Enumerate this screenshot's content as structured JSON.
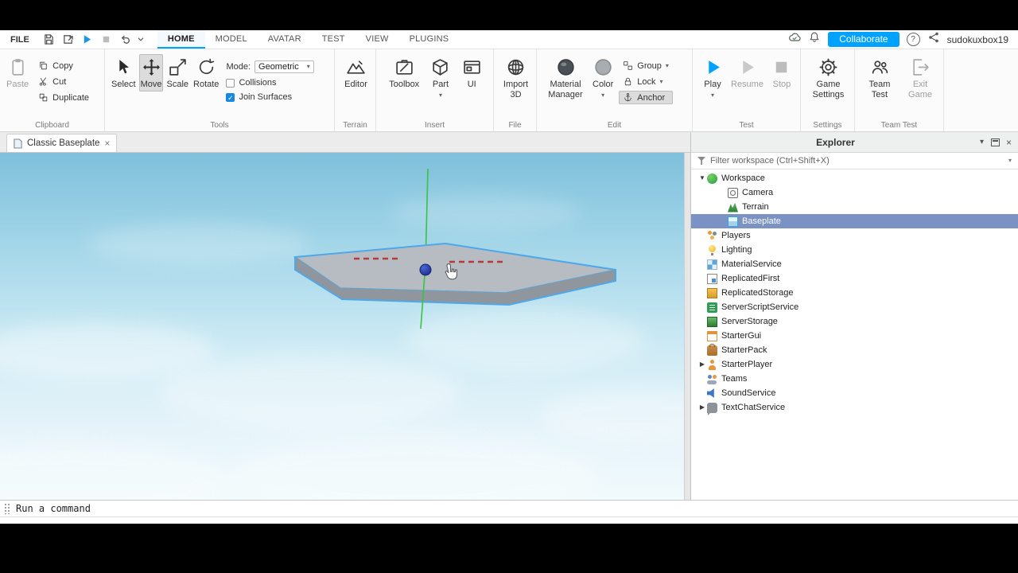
{
  "titlebar": {
    "file_label": "FILE",
    "tabs": [
      {
        "label": "HOME",
        "active": true
      },
      {
        "label": "MODEL",
        "active": false
      },
      {
        "label": "AVATAR",
        "active": false
      },
      {
        "label": "TEST",
        "active": false
      },
      {
        "label": "VIEW",
        "active": false
      },
      {
        "label": "PLUGINS",
        "active": false
      }
    ],
    "quick_icons": [
      "save-icon",
      "publish-icon",
      "play-icon",
      "pause-icon",
      "undo-icon",
      "dropdown-chevron-icon"
    ],
    "right_icons": [
      "cloud-sync-icon",
      "notifications-bell-icon",
      "help-icon",
      "share-icon"
    ],
    "collaborate_label": "Collaborate",
    "username": "sudokuxbox19"
  },
  "ribbon": {
    "clipboard": {
      "section": "Clipboard",
      "paste": "Paste",
      "copy": "Copy",
      "cut": "Cut",
      "duplicate": "Duplicate"
    },
    "tools": {
      "section": "Tools",
      "select": "Select",
      "move": "Move",
      "scale": "Scale",
      "rotate": "Rotate",
      "mode_label": "Mode:",
      "mode_value": "Geometric",
      "collisions": "Collisions",
      "join_surfaces": "Join Surfaces",
      "active_tool": "Move",
      "collisions_checked": false,
      "join_surfaces_checked": true
    },
    "terrain": {
      "section": "Terrain",
      "editor": "Editor"
    },
    "insert": {
      "section": "Insert",
      "toolbox": "Toolbox",
      "part": "Part",
      "ui": "UI"
    },
    "file": {
      "section": "File",
      "import_3d": "Import 3D"
    },
    "edit": {
      "section": "Edit",
      "material_manager": "Material Manager",
      "color": "Color",
      "group": "Group",
      "lock": "Lock",
      "anchor": "Anchor",
      "anchor_active": true
    },
    "test": {
      "section": "Test",
      "play": "Play",
      "resume": "Resume",
      "stop": "Stop"
    },
    "settings": {
      "section": "Settings",
      "game_settings": "Game Settings"
    },
    "team_test": {
      "section": "Team Test",
      "team_test": "Team Test",
      "exit_game": "Exit Game"
    }
  },
  "document_tab": {
    "label": "Classic Baseplate",
    "close": "×"
  },
  "explorer": {
    "title": "Explorer",
    "filter_placeholder": "Filter workspace (Ctrl+Shift+X)",
    "header_icons": [
      "chevron-down-icon",
      "float-panel-icon",
      "close-icon"
    ],
    "tree": [
      {
        "label": "Workspace",
        "depth": 0,
        "expanded": true,
        "icon": "workspace-icon"
      },
      {
        "label": "Camera",
        "depth": 1,
        "icon": "camera-icon"
      },
      {
        "label": "Terrain",
        "depth": 1,
        "icon": "terrain-icon"
      },
      {
        "label": "Baseplate",
        "depth": 1,
        "selected": true,
        "icon": "baseplate-icon"
      },
      {
        "label": "Players",
        "depth": 0,
        "icon": "players-icon"
      },
      {
        "label": "Lighting",
        "depth": 0,
        "icon": "lighting-icon"
      },
      {
        "label": "MaterialService",
        "depth": 0,
        "icon": "material-service-icon"
      },
      {
        "label": "ReplicatedFirst",
        "depth": 0,
        "icon": "replicated-first-icon"
      },
      {
        "label": "ReplicatedStorage",
        "depth": 0,
        "icon": "replicated-storage-icon"
      },
      {
        "label": "ServerScriptService",
        "depth": 0,
        "icon": "server-script-service-icon"
      },
      {
        "label": "ServerStorage",
        "depth": 0,
        "icon": "server-storage-icon"
      },
      {
        "label": "StarterGui",
        "depth": 0,
        "icon": "starter-gui-icon"
      },
      {
        "label": "StarterPack",
        "depth": 0,
        "icon": "starter-pack-icon"
      },
      {
        "label": "StarterPlayer",
        "depth": 0,
        "collapsed": true,
        "icon": "starter-player-icon"
      },
      {
        "label": "Teams",
        "depth": 0,
        "icon": "teams-icon"
      },
      {
        "label": "SoundService",
        "depth": 0,
        "icon": "sound-service-icon"
      },
      {
        "label": "TextChatService",
        "depth": 0,
        "collapsed": true,
        "icon": "text-chat-service-icon"
      }
    ]
  },
  "command_bar": {
    "placeholder": "Run a command"
  },
  "viewport": {
    "selected_object": "Baseplate",
    "gizmo": "move",
    "axis_color": "#35c53f",
    "selection_outline": "#4fa8e8"
  },
  "colors": {
    "accent": "#00a2ff",
    "selection_row": "#7a93c4",
    "check_blue": "#1789e0"
  }
}
